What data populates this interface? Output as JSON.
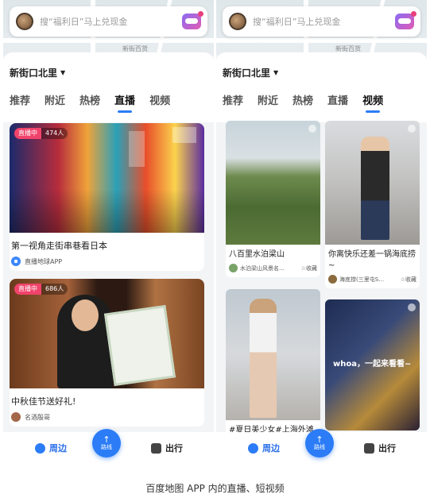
{
  "search": {
    "placeholder": "搜“福利日”马上兑现金"
  },
  "map_labels": [
    "新街百货"
  ],
  "location": {
    "name": "新街口北里"
  },
  "tabs": [
    "推荐",
    "附近",
    "热榜",
    "直播",
    "视频"
  ],
  "left_screen": {
    "active_tab": "直播",
    "cards": [
      {
        "live_label": "直播中",
        "viewers": "474人",
        "title": "第一视角走街串巷看日本",
        "source": "直播地球APP"
      },
      {
        "live_label": "直播中",
        "viewers": "686人",
        "title": "中秋佳节送好礼!",
        "source": "名酒殷哥"
      }
    ]
  },
  "right_screen": {
    "active_tab": "视频",
    "videos": [
      {
        "title": "八百里水泊梁山",
        "source": "水泊梁山风景名…",
        "fav": "收藏"
      },
      {
        "title": "你离快乐还差一锅海底捞~",
        "source": "海底捞(三里屯S…",
        "fav": "收藏"
      },
      {
        "title": "#夏日美少女#上海外滩",
        "source": "",
        "fav": ""
      },
      {
        "title": "",
        "overlay_text": "whoa，一起来看看~",
        "source": "",
        "fav": ""
      }
    ]
  },
  "bottom_nav": {
    "zhoubian": "周边",
    "route": "路线",
    "chuxing": "出行"
  },
  "caption": "百度地图 APP 内的直播、短视频",
  "colors": {
    "accent": "#2b7cf6",
    "live": "#f0436b"
  }
}
